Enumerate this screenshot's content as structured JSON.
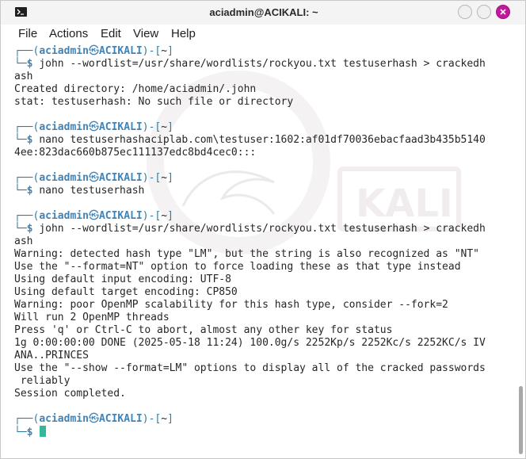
{
  "window": {
    "title": "aciadmin@ACIKALI: ~"
  },
  "menu": {
    "file": "File",
    "actions": "Actions",
    "edit": "Edit",
    "view": "View",
    "help": "Help"
  },
  "prompt": {
    "open": "┌──(",
    "user": "aciadmin",
    "at": "㉿",
    "host": "ACIKALI",
    "close_dir_open": ")-[",
    "dir": "~",
    "dir_close": "]",
    "arrow": "└─",
    "dollar": "$"
  },
  "blocks": [
    {
      "command": "john --wordlist=/usr/share/wordlists/rockyou.txt testuserhash > crackedh",
      "output": [
        "ash",
        "Created directory: /home/aciadmin/.john",
        "stat: testuserhash: No such file or directory"
      ]
    },
    {
      "command": "nano testuserhashaciplab.com\\testuser:1602:af01df70036ebacfaad3b435b5140",
      "output": [
        "4ee:823dac660b875ec111137edc8bd4cec0:::"
      ]
    },
    {
      "command": "nano testuserhash",
      "output": []
    },
    {
      "command": "john --wordlist=/usr/share/wordlists/rockyou.txt testuserhash > crackedh",
      "output": [
        "ash",
        "Warning: detected hash type \"LM\", but the string is also recognized as \"NT\"",
        "Use the \"--format=NT\" option to force loading these as that type instead",
        "Using default input encoding: UTF-8",
        "Using default target encoding: CP850",
        "Warning: poor OpenMP scalability for this hash type, consider --fork=2",
        "Will run 2 OpenMP threads",
        "Press 'q' or Ctrl-C to abort, almost any other key for status",
        "1g 0:00:00:00 DONE (2025-05-18 11:24) 100.0g/s 2252Kp/s 2252Kc/s 2252KC/s IV",
        "ANA..PRINCES",
        "Use the \"--show --format=LM\" options to display all of the cracked passwords",
        " reliably",
        "Session completed."
      ]
    },
    {
      "command": "",
      "output": []
    }
  ],
  "background": {
    "watermark": "KALI"
  },
  "colors": {
    "prompt_blue": "#3f83b7",
    "cursor": "#33b89a",
    "close_button": "#c0199c"
  }
}
